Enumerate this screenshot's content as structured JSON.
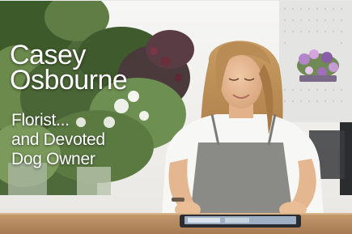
{
  "overlay": {
    "name_line1": "Casey",
    "name_line2": "Osbourne",
    "role_line1": "Florist...",
    "role_line2": "and Devoted",
    "role_line3": "Dog Owner"
  },
  "colors": {
    "caption_text": "#ffffff",
    "background_wall": "#f0efec",
    "foliage": "#3f5a2c",
    "shirt": "#f7f7f5",
    "apron": "#8a8a86",
    "hair": "#c39a63",
    "counter": "#b88c62"
  },
  "scene": {
    "subject": "person-using-tablet",
    "props": [
      "tablet-icon",
      "flower-arrangement-icon",
      "pegboard-icon"
    ]
  }
}
